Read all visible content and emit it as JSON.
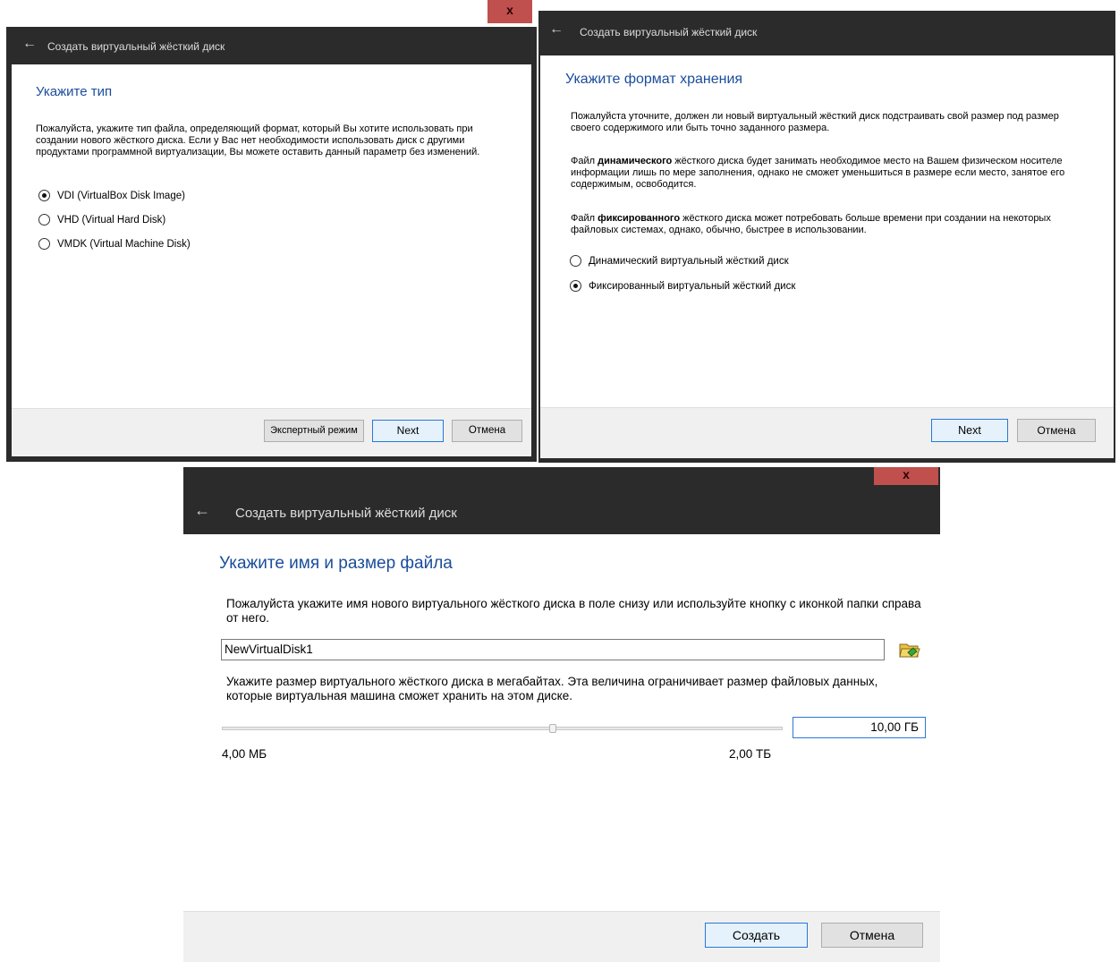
{
  "dialog_type": {
    "window_title": "Создать виртуальный жёсткий диск",
    "close_glyph": "x",
    "heading": "Укажите тип",
    "description": "Пожалуйста, укажите тип файла, определяющий формат, который Вы хотите использовать при создании нового жёсткого диска. Если у Вас нет необходимости использовать диск с другими продуктами программной виртуализации, Вы можете оставить данный параметр без изменений.",
    "options": [
      {
        "label": "VDI (VirtualBox Disk Image)",
        "selected": true
      },
      {
        "label": "VHD (Virtual Hard Disk)",
        "selected": false
      },
      {
        "label": "VMDK (Virtual Machine Disk)",
        "selected": false
      }
    ],
    "buttons": {
      "expert": "Экспертный режим",
      "next": "Next",
      "cancel": "Отмена"
    }
  },
  "dialog_format": {
    "window_title": "Создать виртуальный жёсткий диск",
    "heading": "Укажите формат хранения",
    "intro": "Пожалуйста уточните, должен ли новый виртуальный жёсткий диск подстраивать свой размер под размер своего содержимого или быть точно заданного размера.",
    "dynamic_prefix": "Файл ",
    "dynamic_bold": "динамического",
    "dynamic_rest": " жёсткого диска будет занимать необходимое место на Вашем физическом носителе информации лишь по мере заполнения, однако не сможет уменьшиться в размере если место, занятое его содержимым, освободится.",
    "fixed_prefix": "Файл ",
    "fixed_bold": "фиксированного",
    "fixed_rest": " жёсткого диска может потребовать больше времени при создании на некоторых файловых системах, однако, обычно, быстрее в использовании.",
    "options": [
      {
        "label": "Динамический виртуальный жёсткий диск",
        "selected": false
      },
      {
        "label": "Фиксированный виртуальный жёсткий диск",
        "selected": true
      }
    ],
    "buttons": {
      "next": "Next",
      "cancel": "Отмена"
    }
  },
  "dialog_size": {
    "window_title": "Создать виртуальный жёсткий диск",
    "close_glyph": "x",
    "heading": "Укажите имя и размер файла",
    "name_prompt": "Пожалуйста укажите имя нового виртуального жёсткого диска в поле снизу или используйте кнопку с иконкой папки справа от него.",
    "name_value": "NewVirtualDisk1",
    "size_prompt": "Укажите размер виртуального жёсткого диска в мегабайтах. Эта величина ограничивает размер файловых данных, которые виртуальная машина сможет хранить на этом диске.",
    "size_value": "10,00 ГБ",
    "slider_min": "4,00 МБ",
    "slider_max": "2,00 ТБ",
    "slider_position_fraction": 0.59,
    "buttons": {
      "create": "Создать",
      "cancel": "Отмена"
    }
  },
  "icons": [
    "back-arrow-icon",
    "folder-icon"
  ],
  "colors": {
    "titlebar": "#2b2b2b",
    "heading": "#1b4d9b",
    "close": "#c0504d",
    "default_button_border": "#2a78d6"
  }
}
